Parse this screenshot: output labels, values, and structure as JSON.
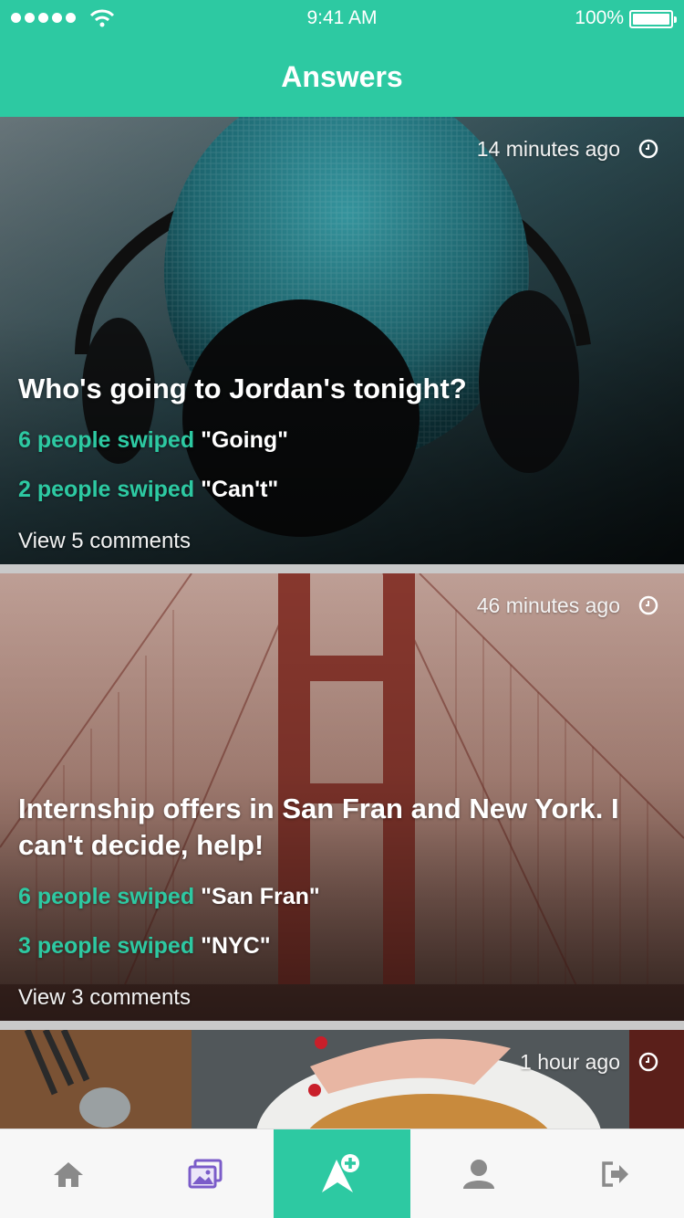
{
  "status_bar": {
    "time": "9:41 AM",
    "battery": "100%"
  },
  "nav": {
    "title": "Answers"
  },
  "feed": [
    {
      "timestamp": "14 minutes ago",
      "question": "Who's going to Jordan's tonight?",
      "results": [
        {
          "count": "6 people swiped",
          "answer": "\"Going\""
        },
        {
          "count": "2 people swiped",
          "answer": "\"Can't\""
        }
      ],
      "comments": "View 5 comments"
    },
    {
      "timestamp": "46 minutes ago",
      "question": "Internship offers in San Fran and New York. I can't decide, help!",
      "results": [
        {
          "count": "6 people swiped",
          "answer": "\"San Fran\""
        },
        {
          "count": "3 people swiped",
          "answer": "\"NYC\""
        }
      ],
      "comments": "View 3 comments"
    },
    {
      "timestamp": "1 hour ago"
    }
  ],
  "tabs": [
    {
      "icon": "home-icon"
    },
    {
      "icon": "photos-icon"
    },
    {
      "icon": "ask-icon",
      "active": true
    },
    {
      "icon": "profile-icon"
    },
    {
      "icon": "logout-icon"
    }
  ],
  "colors": {
    "accent": "#2dc9a2",
    "photos_icon": "#7b5cc9"
  }
}
